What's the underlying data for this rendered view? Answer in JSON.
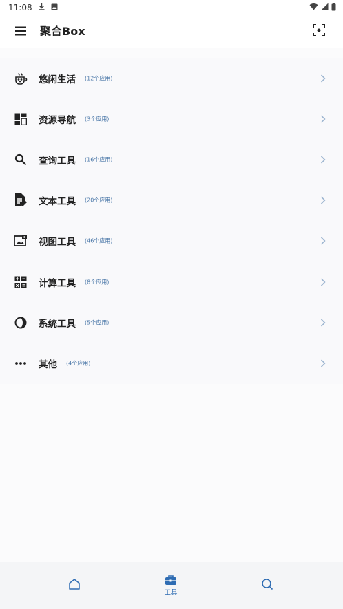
{
  "status_bar": {
    "time": "11:08"
  },
  "app_bar": {
    "title": "聚合Box"
  },
  "categories": [
    {
      "label": "悠闲生活",
      "count": "(12个应用)",
      "icon": "coffee-cup-face-icon"
    },
    {
      "label": "资源导航",
      "count": "(3个应用)",
      "icon": "dashboard-grid-icon"
    },
    {
      "label": "查询工具",
      "count": "(16个应用)",
      "icon": "search-icon"
    },
    {
      "label": "文本工具",
      "count": "(20个应用)",
      "icon": "document-edit-icon"
    },
    {
      "label": "视图工具",
      "count": "(46个应用)",
      "icon": "image-icon"
    },
    {
      "label": "计算工具",
      "count": "(8个应用)",
      "icon": "calculator-icon"
    },
    {
      "label": "系统工具",
      "count": "(5个应用)",
      "icon": "contrast-circle-icon"
    },
    {
      "label": "其他",
      "count": "(4个应用)",
      "icon": "more-dots-icon"
    }
  ],
  "bottom_nav": {
    "items": [
      {
        "id": "home",
        "label": "",
        "icon": "home-icon"
      },
      {
        "id": "tools",
        "label": "工具",
        "icon": "toolbox-icon",
        "active": true
      },
      {
        "id": "search",
        "label": "",
        "icon": "search-icon"
      }
    ]
  },
  "colors": {
    "accent": "#2e6cb3",
    "count_text": "#4a77a8",
    "chevron": "#9bb4cf"
  }
}
